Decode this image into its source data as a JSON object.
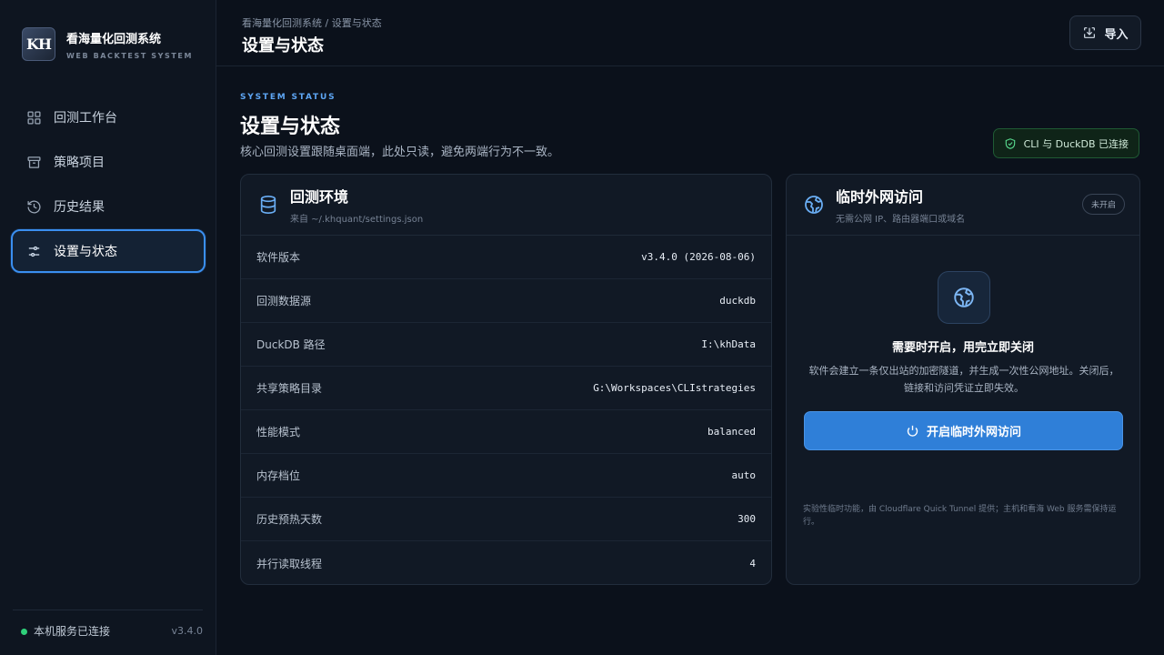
{
  "app": {
    "brand_logo": "KH",
    "brand_name": "看海量化回测系统",
    "brand_sub": "WEB BACKTEST SYSTEM"
  },
  "sidebar": {
    "items": [
      {
        "label": "回测工作台",
        "icon": "grid-icon"
      },
      {
        "label": "策略项目",
        "icon": "archive-icon"
      },
      {
        "label": "历史结果",
        "icon": "history-icon"
      },
      {
        "label": "设置与状态",
        "icon": "sliders-icon",
        "active": true
      }
    ],
    "footer_status": "本机服务已连接",
    "footer_version": "v3.4.0"
  },
  "header": {
    "breadcrumb": "看海量化回测系统 / 设置与状态",
    "title": "设置与状态",
    "import_label": "导入"
  },
  "main": {
    "eyebrow": "SYSTEM STATUS",
    "title": "设置与状态",
    "description": "核心回测设置跟随桌面端，此处只读，避免两端行为不一致。",
    "connection_badge": "CLI 与 DuckDB 已连接"
  },
  "env_card": {
    "title": "回测环境",
    "subtitle": "来自 ~/.khquant/settings.json",
    "rows": [
      {
        "key": "软件版本",
        "value": "v3.4.0 (2026-08-06)"
      },
      {
        "key": "回测数据源",
        "value": "duckdb"
      },
      {
        "key": "DuckDB 路径",
        "value": "I:\\khData"
      },
      {
        "key": "共享策略目录",
        "value": "G:\\Workspaces\\CLIstrategies"
      },
      {
        "key": "性能模式",
        "value": "balanced"
      },
      {
        "key": "内存档位",
        "value": "auto"
      },
      {
        "key": "历史预热天数",
        "value": "300"
      },
      {
        "key": "并行读取线程",
        "value": "4"
      }
    ]
  },
  "tunnel_card": {
    "title": "临时外网访问",
    "subtitle": "无需公网 IP、路由器端口或域名",
    "status_badge": "未开启",
    "heading": "需要时开启，用完立即关闭",
    "description": "软件会建立一条仅出站的加密隧道，并生成一次性公网地址。关闭后，链接和访问凭证立即失效。",
    "button_label": "开启临时外网访问",
    "note": "实验性临时功能，由 Cloudflare Quick Tunnel 提供；主机和看海 Web 服务需保持运行。"
  },
  "colors": {
    "accent": "#2f7fd8",
    "background": "#0b111b",
    "success": "#2fd07a"
  }
}
